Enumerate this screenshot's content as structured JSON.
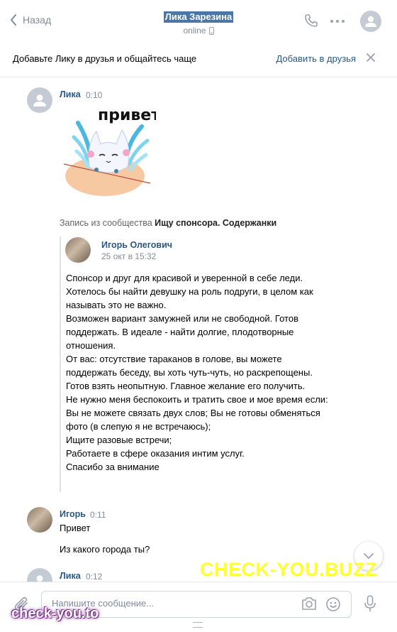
{
  "header": {
    "back_label": "Назад",
    "contact_name": "Лика Зарезина",
    "status": "online"
  },
  "banner": {
    "text": "Добавьте Лику в друзья и общайтесь чаще",
    "action": "Добавить в друзья"
  },
  "messages": {
    "m1": {
      "name": "Лика",
      "time": "0:10",
      "sticker_text": "привет"
    },
    "repost": {
      "source_prefix": "Запись из сообщества",
      "source_name": "Ищу спонсора. Содержанки",
      "author": "Игорь Олегович",
      "date": "25 окт в 15:32",
      "lines": [
        "Спонсор и друг для красивой и уверенной в себе леди.",
        "Хотелось бы найти девушку на роль подруги, в целом как называть это не важно.",
        "Возможен вариант замужней или не свободной. Готов поддержать. В идеале - найти долгие, плодотворные отношения.",
        "От вас: отсутствие тараканов в голове, вы можете поддержать беседу, вы хоть чуть-чуть, но раскрепощены.",
        "Готов взять неопытную. Главное желание его получить.",
        "Не нужно меня беспокоить и тратить свое и мое время если:",
        "Вы не можете связать двух слов; Вы не готовы обменяться фото (в слепую я не встречаюсь);",
        "Ищите разовые встречи;",
        "Работаете в сфере оказания интим услуг.",
        "Спасибо за внимание"
      ]
    },
    "m2": {
      "name": "Игорь",
      "time": "0:11",
      "text1": "Привет",
      "text2": "Из какого города ты?"
    },
    "m3": {
      "name": "Лика",
      "time": "0:12"
    }
  },
  "composer": {
    "placeholder": "Напишите сообщение..."
  },
  "watermarks": {
    "big": "CHECK-YOU.BUZZ",
    "small": "check-you.to"
  }
}
